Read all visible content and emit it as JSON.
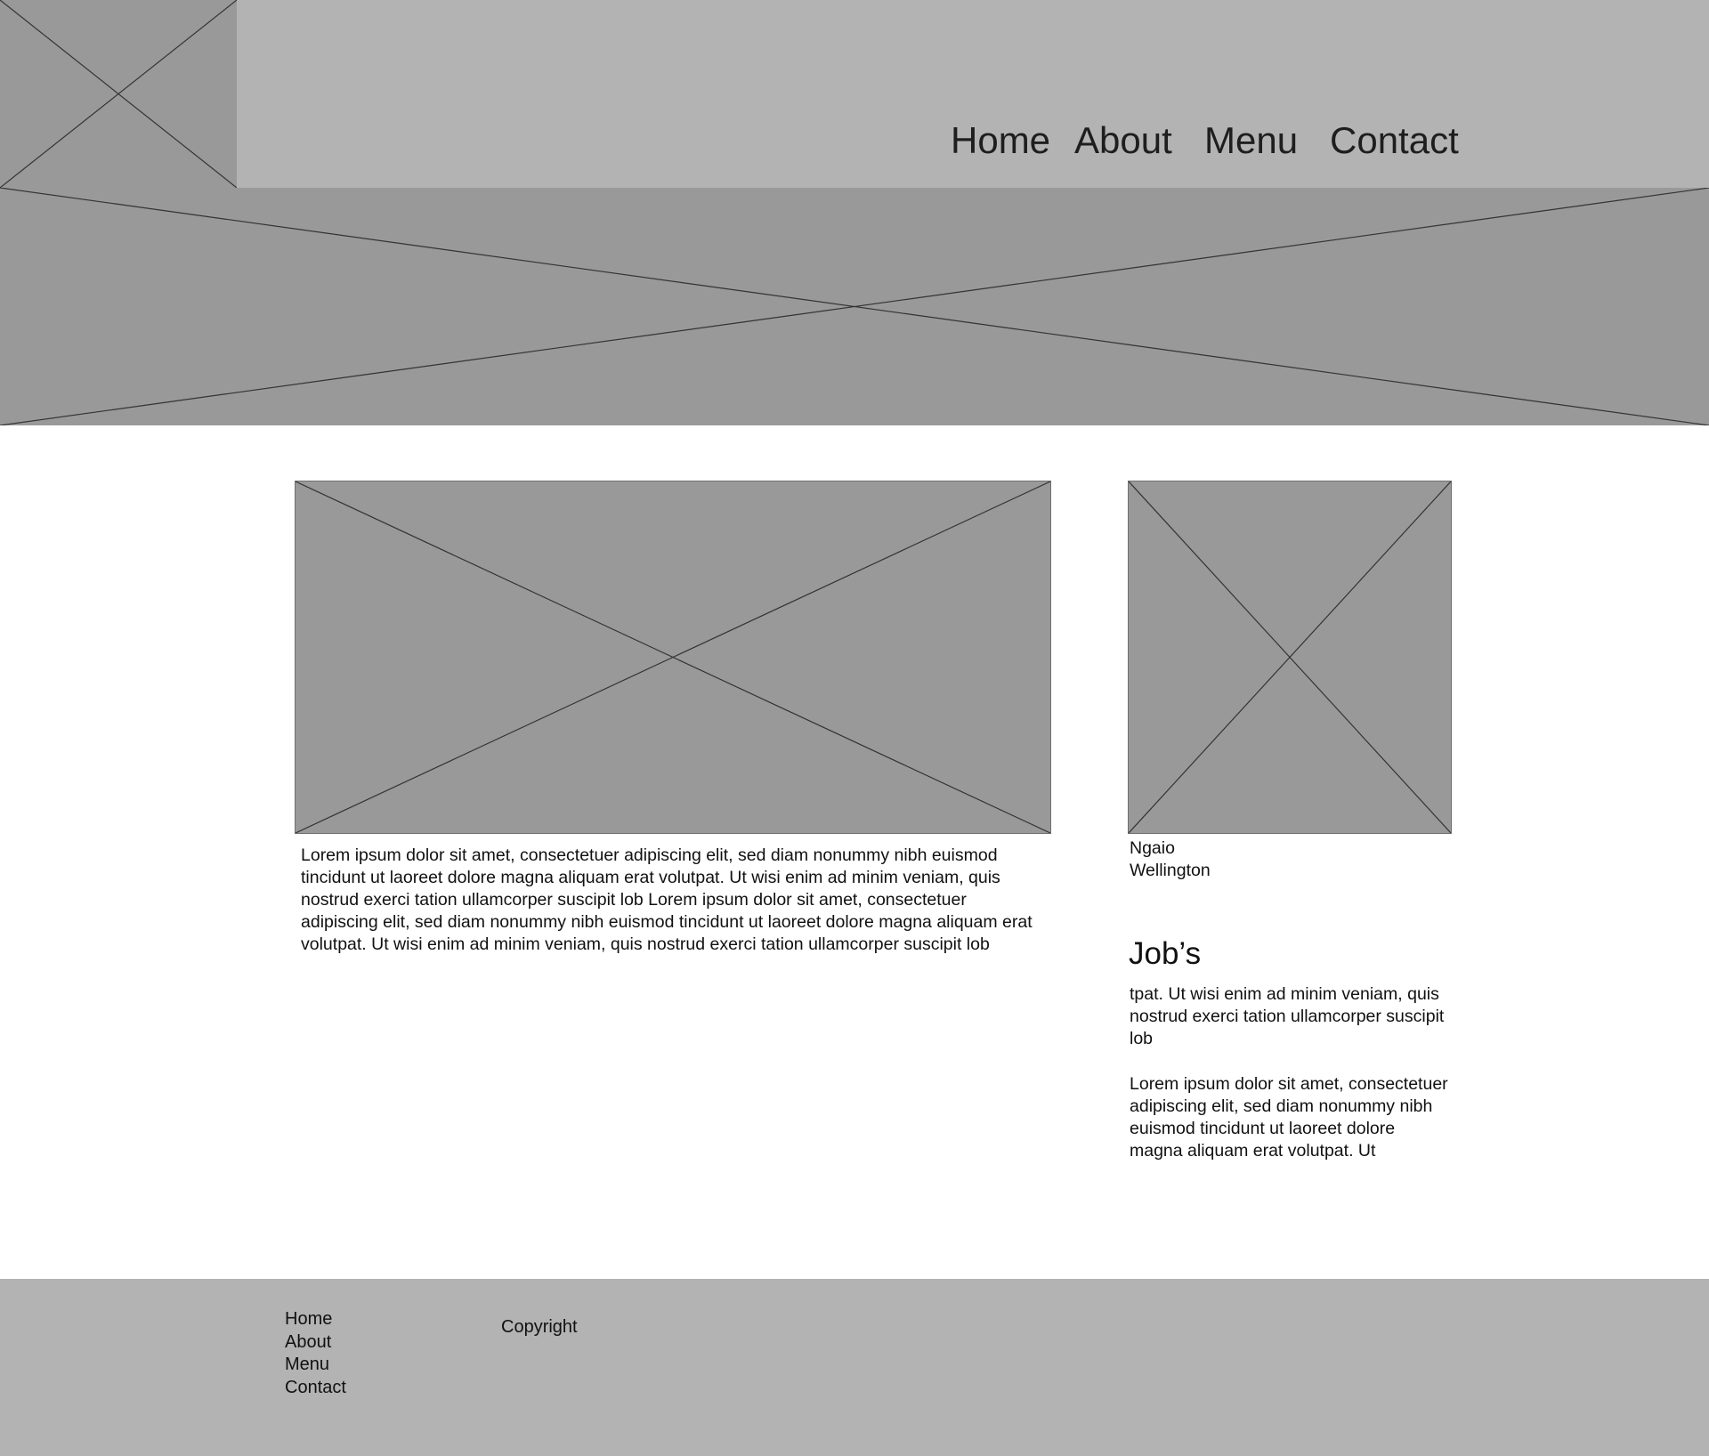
{
  "header": {
    "nav": [
      "Home",
      "About",
      "Menu",
      "Contact"
    ]
  },
  "main": {
    "article_text": "Lorem ipsum dolor sit amet, consectetuer adipiscing elit, sed diam nonummy nibh euismod tincidunt ut laoreet dolore magna aliquam erat volutpat. Ut wisi enim ad minim veniam, quis nostrud exerci tation ullamcorper suscipit lob Lorem ipsum dolor sit amet, consectetuer adipiscing elit, sed diam nonummy nibh euismod tincidunt ut laoreet dolore magna aliquam erat volutpat. Ut wisi enim ad minim veniam, quis nostrud exerci tation ullamcorper suscipit lob"
  },
  "sidebar": {
    "location_line1": "Ngaio",
    "location_line2": "Wellington",
    "jobs_title": "Job’s",
    "jobs_paragraph1": "tpat. Ut wisi enim ad minim veniam, quis nostrud exerci tation ullamcorper suscipit lob",
    "jobs_paragraph2": "Lorem ipsum dolor sit amet, consectetuer adipiscing elit, sed diam nonummy nibh euismod tincidunt ut laoreet dolore magna aliquam erat volutpat. Ut"
  },
  "footer": {
    "links": [
      "Home",
      "About",
      "Menu",
      "Contact"
    ],
    "copyright": "Copyright"
  },
  "colors": {
    "header_bg": "#b3b3b3",
    "placeholder": "#999999",
    "footer_bg": "#b3b3b3",
    "text": "#111111"
  }
}
